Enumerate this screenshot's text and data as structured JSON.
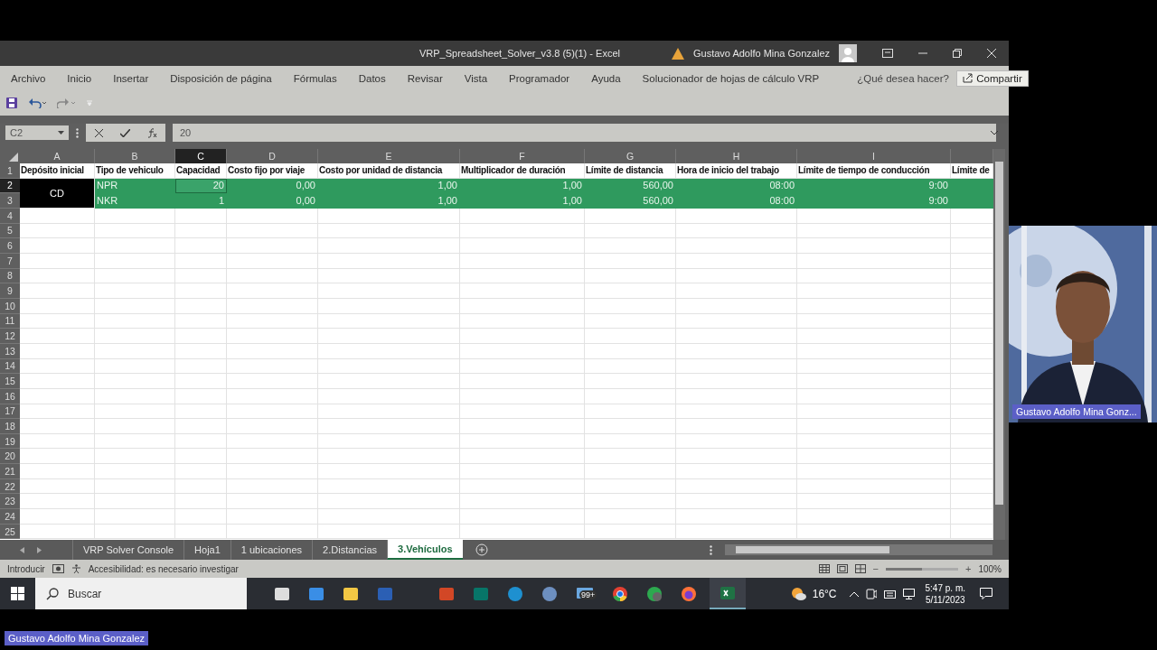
{
  "window": {
    "title": "VRP_Spreadsheet_Solver_v3.8 (5)(1)  -  Excel",
    "user": "Gustavo Adolfo Mina Gonzalez"
  },
  "ribbon_tabs": [
    "Archivo",
    "Inicio",
    "Insertar",
    "Disposición de página",
    "Fórmulas",
    "Datos",
    "Revisar",
    "Vista",
    "Programador",
    "Ayuda",
    "Solucionador de hojas de cálculo VRP"
  ],
  "tell_me": {
    "placeholder": "¿Qué desea hacer?"
  },
  "share_button": "Compartir",
  "formula_bar": {
    "name_box": "C2",
    "value": "20"
  },
  "columns": [
    {
      "letter": "A",
      "selected": false
    },
    {
      "letter": "B",
      "selected": false
    },
    {
      "letter": "C",
      "selected": true
    },
    {
      "letter": "D",
      "selected": false
    },
    {
      "letter": "E",
      "selected": false
    },
    {
      "letter": "F",
      "selected": false
    },
    {
      "letter": "G",
      "selected": false
    },
    {
      "letter": "H",
      "selected": false
    },
    {
      "letter": "I",
      "selected": false
    }
  ],
  "header_row": {
    "number": "1",
    "cells": [
      "Depósito inicial",
      "Tipo de vehiculo",
      "Capacidad",
      "Costo fijo por viaje",
      "Costo por unidad de distancia",
      "Multiplicador de duración",
      "Límite de distancia",
      "Hora de inicio del trabajo",
      "Límite de tiempo de conducción",
      "Límite de"
    ]
  },
  "depot": "CD",
  "data_rows": [
    {
      "number": "2",
      "selected": true,
      "cells": [
        {
          "text": "NPR",
          "selected": false
        },
        {
          "text": "20",
          "selected": true
        },
        {
          "text": "0,00",
          "selected": false
        },
        {
          "text": "1,00",
          "selected": false
        },
        {
          "text": "1,00",
          "selected": false
        },
        {
          "text": "560,00",
          "selected": false
        },
        {
          "text": "08:00",
          "selected": false
        },
        {
          "text": "9:00",
          "selected": false
        }
      ]
    },
    {
      "number": "3",
      "selected": false,
      "cells": [
        {
          "text": "NKR",
          "selected": false
        },
        {
          "text": "1",
          "selected": false
        },
        {
          "text": "0,00",
          "selected": false
        },
        {
          "text": "1,00",
          "selected": false
        },
        {
          "text": "1,00",
          "selected": false
        },
        {
          "text": "560,00",
          "selected": false
        },
        {
          "text": "08:00",
          "selected": false
        },
        {
          "text": "9:00",
          "selected": false
        }
      ]
    }
  ],
  "empty_rows": [
    "4",
    "5",
    "6",
    "7",
    "8",
    "9",
    "10",
    "11",
    "12",
    "13",
    "14",
    "15",
    "16",
    "17",
    "18",
    "19",
    "20",
    "21",
    "22",
    "23",
    "24",
    "25"
  ],
  "sheet_tabs": [
    {
      "label": "VRP Solver Console",
      "selected": false
    },
    {
      "label": "Hoja1",
      "selected": false
    },
    {
      "label": "1 ubicaciones",
      "selected": false
    },
    {
      "label": "2.Distancias",
      "selected": false
    },
    {
      "label": "3.Vehículos",
      "selected": true
    }
  ],
  "status_bar": {
    "mode": "Introducir",
    "accessibility": "Accesibilidad: es necesario investigar",
    "zoom": "100%",
    "zoom_out": "−",
    "zoom_in": "+",
    "zoom_slider": {
      "level": 0.5
    }
  },
  "taskbar": {
    "search": {
      "placeholder": "Buscar"
    },
    "mail_badge": "99+",
    "temperature": "16°C",
    "time": "5:47 p. m.",
    "date": "5/11/2023"
  },
  "video_tile": {
    "name": "Gustavo Adolfo Mina Gonz..."
  },
  "presenter_label": "Gustavo Adolfo Mina Gonzalez"
}
